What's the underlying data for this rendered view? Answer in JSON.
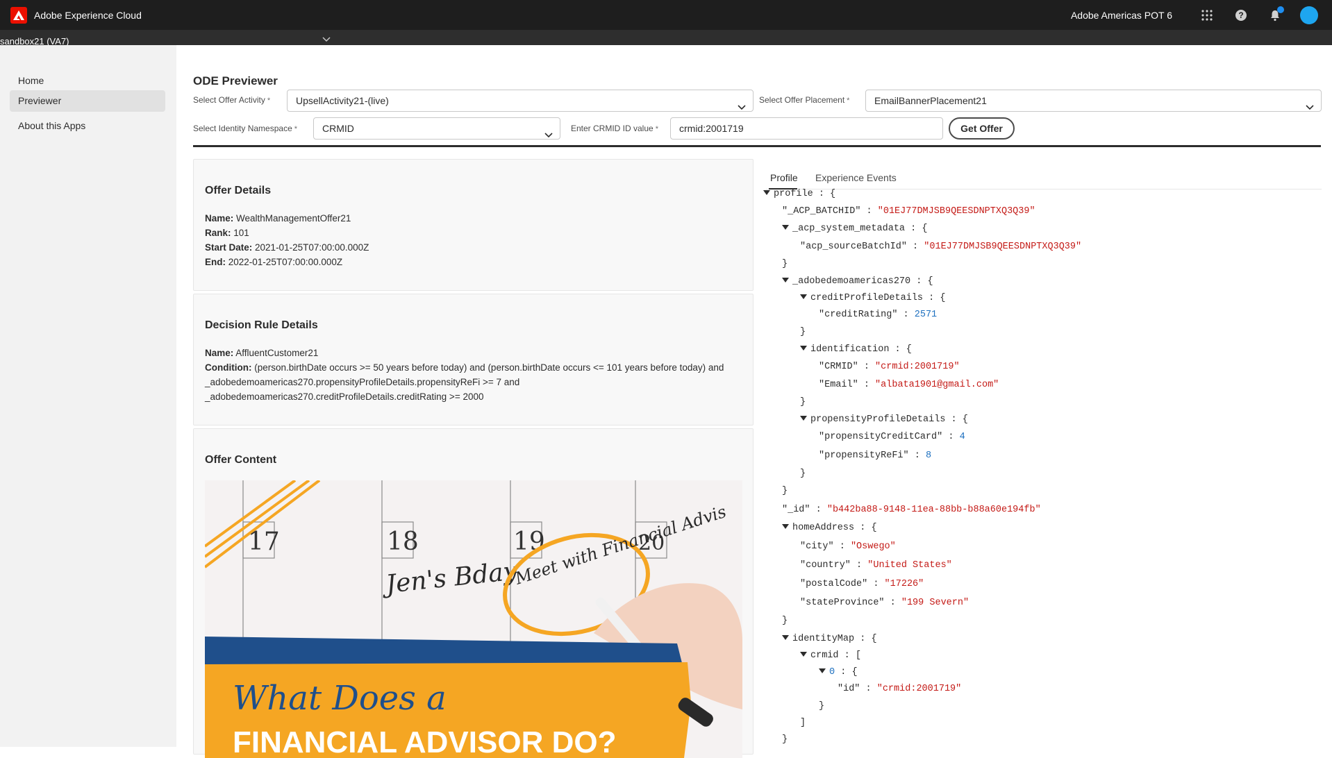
{
  "topbar": {
    "app_title": "Adobe Experience Cloud",
    "org": "Adobe Americas POT 6",
    "icons": [
      "adobe-logo-icon",
      "apps-grid-icon",
      "help-icon",
      "notifications-bell-icon",
      "avatar"
    ],
    "brand_color": "#eb1000"
  },
  "sandbox": {
    "label": "sandbox21 (VA7)"
  },
  "sidebar": {
    "items": [
      {
        "label": "Home"
      },
      {
        "label": "Previewer"
      },
      {
        "label": "About this Apps"
      }
    ]
  },
  "main": {
    "title": "ODE Previewer",
    "offer_activity": {
      "label": "Select Offer Activity",
      "value": "UpsellActivity21-(live)"
    },
    "offer_placement": {
      "label": "Select Offer Placement",
      "value": "EmailBannerPlacement21"
    },
    "identity_namespace": {
      "label": "Select Identity Namespace",
      "value": "CRMID"
    },
    "crmid": {
      "label": "Enter CRMID ID value",
      "value": "crmid:2001719"
    },
    "get_offer_label": "Get Offer",
    "required_mark": "*"
  },
  "offer_details": {
    "title": "Offer Details",
    "name_k": "Name:",
    "name_v": "WealthManagementOffer21",
    "rank_k": "Rank:",
    "rank_v": "101",
    "start_k": "Start Date:",
    "start_v": "2021-01-25T07:00:00.000Z",
    "end_k": "End:",
    "end_v": "2022-01-25T07:00:00.000Z"
  },
  "decision_rule": {
    "title": "Decision Rule Details",
    "name_k": "Name:",
    "name_v": "AffluentCustomer21",
    "cond_k": "Condition:",
    "cond_v": "(person.birthDate occurs >= 50 years before today) and (person.birthDate occurs <= 101 years before today) and _adobedemoamericas270.propensityProfileDetails.propensityReFi >= 7 and _adobedemoamericas270.creditProfileDetails.creditRating >= 2000"
  },
  "offer_content": {
    "title": "Offer Content",
    "calendar_days": [
      "17",
      "18",
      "19",
      "20"
    ],
    "note1": "Jen's Bday",
    "note2": "Meet with Financial Advis",
    "headline1": "What Does a",
    "headline2": "FINANCIAL ADVISOR DO?"
  },
  "tabs": {
    "profile": "Profile",
    "events": "Experience Events"
  },
  "json": {
    "l0": "profile",
    "l1k": "\"_ACP_BATCHID\"",
    "l1v": "\"01EJ77DMJSB9QEESDNPTXQ3Q39\"",
    "l2": "_acp_system_metadata",
    "l3k": "\"acp_sourceBatchId\"",
    "l3v": "\"01EJ77DMJSB9QEESDNPTXQ3Q39\"",
    "l5": "_adobedemoamericas270",
    "l6": "creditProfileDetails",
    "l7k": "\"creditRating\"",
    "l7v": "2571",
    "l9": "identification",
    "l10k": "\"CRMID\"",
    "l10v": "\"crmid:2001719\"",
    "l11k": "\"Email\"",
    "l11v": "\"albata1901@gmail.com\"",
    "l13": "propensityProfileDetails",
    "l14k": "\"propensityCreditCard\"",
    "l14v": "4",
    "l15k": "\"propensityReFi\"",
    "l15v": "8",
    "l18k": "\"_id\"",
    "l18v": "\"b442ba88-9148-11ea-88bb-b88a60e194fb\"",
    "l19": "homeAddress",
    "l20k": "\"city\"",
    "l20v": "\"Oswego\"",
    "l21k": "\"country\"",
    "l21v": "\"United States\"",
    "l22k": "\"postalCode\"",
    "l22v": "\"17226\"",
    "l23k": "\"stateProvince\"",
    "l23v": "\"199 Severn\"",
    "l25": "identityMap",
    "l26": "crmid",
    "l27": "0",
    "l28k": "\"id\"",
    "l28v": "\"crmid:2001719\"",
    "sep": ":",
    "open_obj": "{",
    "close_obj": "}",
    "open_arr": "[",
    "close_arr": "]"
  }
}
